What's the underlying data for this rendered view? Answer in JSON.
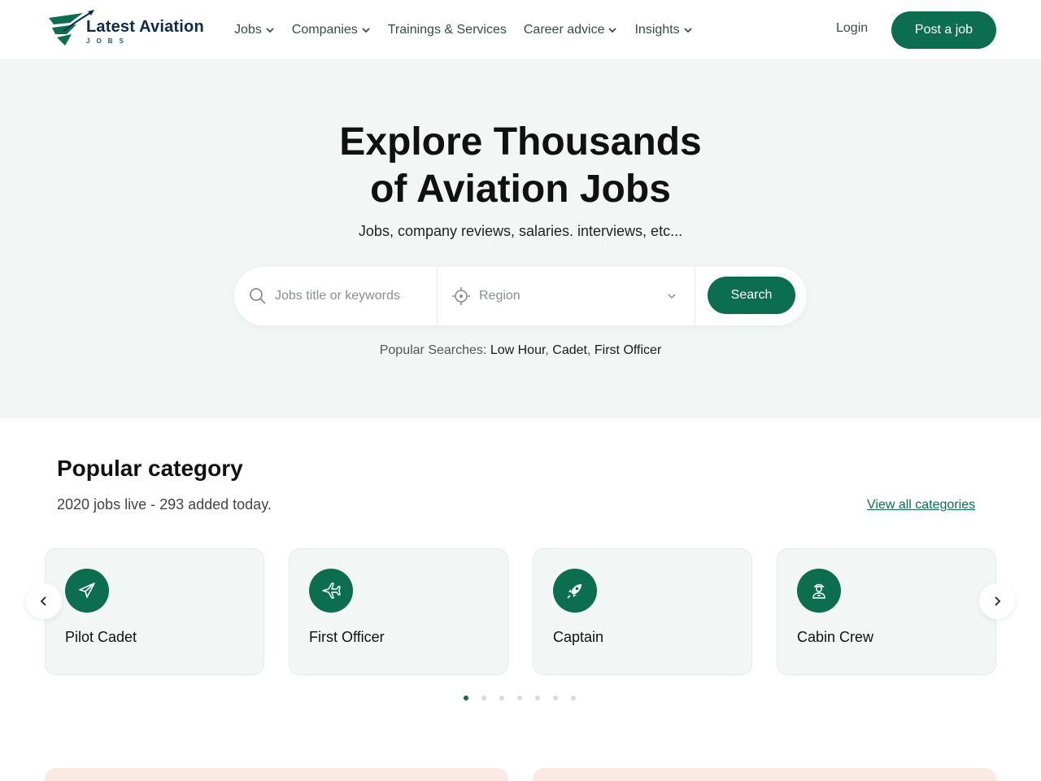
{
  "header": {
    "logo_text": "Latest Aviation",
    "logo_sub": "JOBS",
    "nav": [
      {
        "label": "Jobs",
        "has_dropdown": true
      },
      {
        "label": "Companies",
        "has_dropdown": true
      },
      {
        "label": "Trainings & Services",
        "has_dropdown": false
      },
      {
        "label": "Career advice",
        "has_dropdown": true
      },
      {
        "label": "Insights",
        "has_dropdown": true
      }
    ],
    "login_label": "Login",
    "post_job_label": "Post a job"
  },
  "hero": {
    "title": "Explore Thousands of Aviation Jobs",
    "subtitle": "Jobs, company reviews, salaries. interviews, etc...",
    "search": {
      "keyword_placeholder": "Jobs title or keywords",
      "region_label": "Region",
      "button_label": "Search"
    },
    "popular": {
      "prefix": "Popular Searches:",
      "terms": [
        "Low Hour",
        "Cadet",
        "First Officer"
      ]
    }
  },
  "category": {
    "title": "Popular category",
    "subtitle": "2020 jobs live - 293 added today.",
    "view_all_label": "View all categories",
    "cards": [
      {
        "label": "Pilot Cadet",
        "icon": "paper-plane-icon"
      },
      {
        "label": "First Officer",
        "icon": "airplane-icon"
      },
      {
        "label": "Captain",
        "icon": "rocket-icon"
      },
      {
        "label": "Cabin Crew",
        "icon": "crew-member-icon"
      }
    ],
    "carousel": {
      "total_pages": 7,
      "active_page": 1
    }
  },
  "colors": {
    "brand": "#0a6e4f",
    "hero_bg": "#f2f7f5",
    "card_bg": "#f2f7f5",
    "logo_text": "#0b2c4f",
    "bottom_card": "#fbe9e3"
  }
}
